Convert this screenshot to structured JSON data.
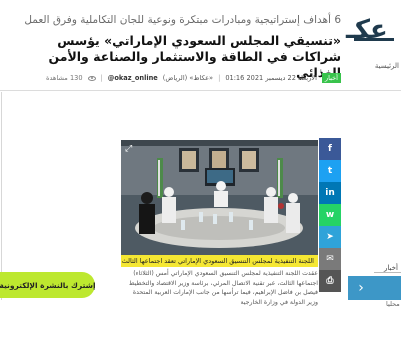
{
  "brand": {
    "logo_text": "عكـ",
    "nav_home": "الرئيسية"
  },
  "article": {
    "kicker": "6 أهداف إستراتيجية ومبادرات مبتكرة ونوعية للجان التكاملية وفرق العمل",
    "headline": "«تنسيقي المجلس السعودي الإماراتي» يؤسس شراكات في الطاقة والاستثمار والصناعة والأمن الغذائي",
    "meta": {
      "tag": "أخبار",
      "date": "الأربعاء 22 ديسمبر 2021 01:16",
      "source": "«عكاظ» (الرياض)",
      "author": "okaz_online@",
      "views": "130 مشاهدة"
    },
    "photo_caption": "اللجنة التنفيذية لمجلس التنسيق السعودي الإماراتي تعقد اجتماعها الثالث. (واس)",
    "body": "عقدت اللجنة التنفيذية لمجلس التنسيق السعودي الإماراتي أمس (الثلاثاء) اجتماعها الثالث، عبر تقنية الاتصال المرئي، برئاسة وزير الاقتصاد والتخطيط فيصل بن فاضل الإبراهيم، فيما ترأسها من جانب الإمارات العربية المتحدة وزير الدولة في وزارة الخارجية"
  },
  "share": {
    "items": [
      {
        "name": "facebook-icon",
        "glyph": "f",
        "color": "#3b5998"
      },
      {
        "name": "twitter-icon",
        "glyph": "t",
        "color": "#1da1f2"
      },
      {
        "name": "linkedin-icon",
        "glyph": "in",
        "color": "#0077b5"
      },
      {
        "name": "whatsapp-icon",
        "glyph": "w",
        "color": "#25d366"
      },
      {
        "name": "telegram-icon",
        "glyph": "➤",
        "color": "#2fa3d9"
      },
      {
        "name": "email-icon",
        "glyph": "✉",
        "color": "#7a7a7a"
      },
      {
        "name": "print-icon",
        "glyph": "⎙",
        "color": "#555555"
      }
    ]
  },
  "newsletter": {
    "label": "إشترك بالنشرة الإلكترونية"
  },
  "sidebar": {
    "label": "أخبار",
    "sub_label": "محليا"
  },
  "promo": {
    "icon": "chevron-right-icon",
    "glyph": "›"
  }
}
